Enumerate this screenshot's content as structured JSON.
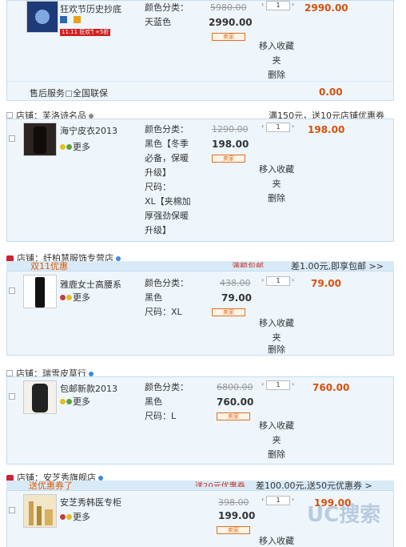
{
  "item1": {
    "title": "狂欢节历史抄底",
    "badge_1111": "11.11 狂欢节",
    "badge_discount": "+5折",
    "attr": "颜色分类：\n天蓝色",
    "orig_price": "5980.00",
    "price": "2990.00",
    "badge_label": "卖家",
    "qty": "1",
    "subtotal": "2990.00",
    "ops": [
      "移入收藏",
      "夹",
      "删除"
    ],
    "service_label": "售后服务",
    "service_value": "全国联保",
    "service_price": "0.00"
  },
  "shop2": {
    "name": "店铺：芙洛诗名品",
    "promo_right": "满150元，送10元店铺优惠券",
    "item": {
      "title": "海宁皮衣2013",
      "more": "更多",
      "attr": [
        "颜色分类：",
        "黑色【冬季",
        "必备，保暖",
        "升级】",
        "尺码：",
        "XL【夹棉加",
        "厚强劲保暖",
        "升级】"
      ],
      "orig_price": "1290.00",
      "price": "198.00",
      "badge_label": "卖家",
      "qty": "1",
      "subtotal": "198.00",
      "ops": [
        "移入收藏",
        "夹",
        "删除"
      ]
    }
  },
  "shop3": {
    "name": "店铺：纤柏慧服饰专营店",
    "promo_tag": "双11优惠",
    "promo_mid": "满额包邮",
    "promo_right": "差1.00元,即享包邮 >>",
    "item": {
      "title": "雅鹿女士高腰系",
      "more": "更多",
      "attr": [
        "颜色分类：",
        "黑色",
        "尺码：XL"
      ],
      "orig_price": "438.00",
      "price": "79.00",
      "badge_label": "卖家",
      "qty": "1",
      "subtotal": "79.00",
      "ops": [
        "移入收藏",
        "夹",
        "删除"
      ]
    }
  },
  "shop4": {
    "name": "店铺：瑞雪皮草行",
    "item": {
      "title": "包邮新款2013",
      "more": "更多",
      "attr": [
        "颜色分类：",
        "黑色",
        "尺码：L"
      ],
      "orig_price": "6800.00",
      "price": "760.00",
      "badge_label": "卖家",
      "qty": "1",
      "subtotal": "760.00",
      "ops": [
        "移入收藏",
        "夹",
        "删除"
      ]
    }
  },
  "shop5": {
    "name": "店铺：安芝秀旗舰店",
    "promo_tag": "送优惠券了",
    "promo_mid": "送20元优惠券",
    "promo_right": "差100.00元,送50元优惠券 >",
    "item": {
      "title": "安芝秀韩医专柜",
      "more": "更多",
      "orig_price": "398.00",
      "price": "199.00",
      "badge_label": "卖家",
      "qty": "1",
      "subtotal": "199.00",
      "ops": [
        "移入收藏"
      ]
    }
  },
  "watermark": "UC搜索",
  "colors": {
    "accent": "#d94f0a",
    "box_bg": "#eef6fc",
    "box_border": "#c5dcee",
    "promo_bar": "#d8e9f7"
  }
}
